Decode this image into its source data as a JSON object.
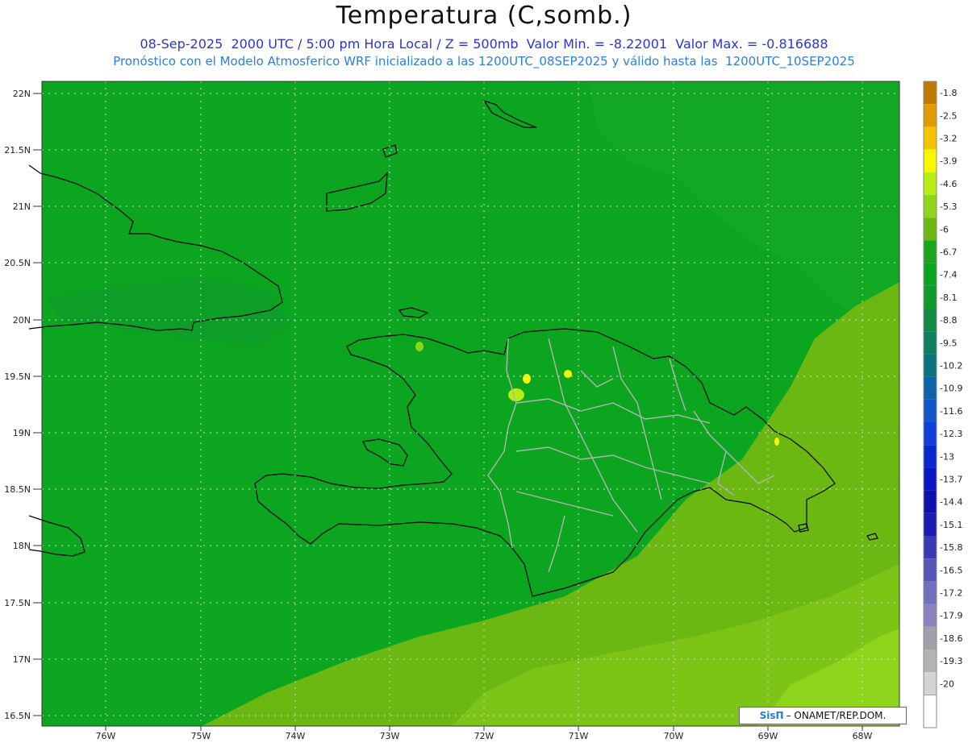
{
  "header": {
    "title": "Temperatura (C,somb.)",
    "subtitle_1": "08-Sep-2025  2000 UTC / 5:00 pm Hora Local / Z = 500mb  Valor Min. = -8.22001  Valor Max. = -0.816688",
    "subtitle_2": "Pronóstico con el Modelo Atmosferico WRF inicializado a las 1200UTC_08SEP2025 y válido hasta las  1200UTC_10SEP2025"
  },
  "map": {
    "lat_labels": [
      "22N",
      "21.5N",
      "21N",
      "20.5N",
      "20N",
      "19.5N",
      "19N",
      "18.5N",
      "18N",
      "17.5N",
      "17N",
      "16.5N"
    ],
    "lon_labels": [
      "76W",
      "75W",
      "74W",
      "73W",
      "72W",
      "71W",
      "70W",
      "69W",
      "68W"
    ]
  },
  "legend": {
    "items": [
      {
        "label": "-1.8",
        "color": "#c07a00"
      },
      {
        "label": "-2.5",
        "color": "#e39c00"
      },
      {
        "label": "-3.2",
        "color": "#f5c400"
      },
      {
        "label": "-3.9",
        "color": "#f8f800"
      },
      {
        "label": "-4.6",
        "color": "#b9ed14"
      },
      {
        "label": "-5.3",
        "color": "#8ed41a"
      },
      {
        "label": "-6",
        "color": "#6ab811"
      },
      {
        "label": "-6.7",
        "color": "#1aa51a"
      },
      {
        "label": "-7.4",
        "color": "#0ca51f"
      },
      {
        "label": "-8.1",
        "color": "#0f9a2e"
      },
      {
        "label": "-8.8",
        "color": "#128c45"
      },
      {
        "label": "-9.5",
        "color": "#0e8060"
      },
      {
        "label": "-10.2",
        "color": "#0d7380"
      },
      {
        "label": "-10.9",
        "color": "#0e64a8"
      },
      {
        "label": "-11.6",
        "color": "#1256c8"
      },
      {
        "label": "-12.3",
        "color": "#1040d8"
      },
      {
        "label": "-13",
        "color": "#0a28d0"
      },
      {
        "label": "-13.7",
        "color": "#0a18c4"
      },
      {
        "label": "-14.4",
        "color": "#1010b0"
      },
      {
        "label": "-15.1",
        "color": "#1c1cb0"
      },
      {
        "label": "-15.8",
        "color": "#3a3ab4"
      },
      {
        "label": "-16.5",
        "color": "#5656b8"
      },
      {
        "label": "-17.2",
        "color": "#7070bc"
      },
      {
        "label": "-17.9",
        "color": "#8c80c0"
      },
      {
        "label": "-18.6",
        "color": "#a0a0a8"
      },
      {
        "label": "-19.3",
        "color": "#b4b4b4"
      },
      {
        "label": "-20",
        "color": "#d4d4d4"
      }
    ]
  },
  "credit": {
    "logo": "SisΠ",
    "text": "– ONAMET/REP.DOM."
  },
  "colors": {
    "field_main": "#0ca51f",
    "field_warm": "#6ab811",
    "field_warmer": "#8ed41a",
    "coast": "#000000",
    "border": "#b4b4b4"
  }
}
